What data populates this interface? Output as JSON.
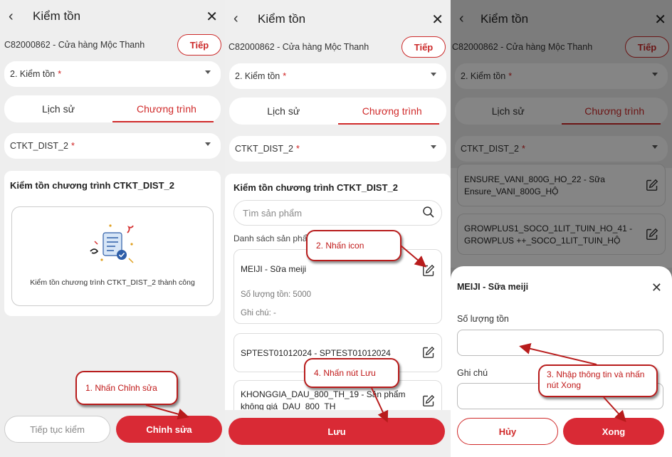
{
  "common": {
    "back_icon": "‹",
    "close_icon": "✕",
    "title": "Kiểm tồn",
    "store": "C82000862 - Cửa hàng Mộc Thanh",
    "next_label": "Tiếp",
    "step_select": "2. Kiểm tồn",
    "required_mark": "*",
    "tab_history": "Lịch sử",
    "tab_program": "Chương trình",
    "program_select": "CTKT_DIST_2"
  },
  "screen1": {
    "card_title": "Kiểm tồn chương trình CTKT_DIST_2",
    "success_message": "Kiểm tồn chương trình CTKT_DIST_2 thành công",
    "continue_label": "Tiếp tục kiểm",
    "edit_label": "Chỉnh sửa"
  },
  "screen2": {
    "card_title": "Kiểm tồn chương trình CTKT_DIST_2",
    "search_placeholder": "Tìm sản phẩm",
    "list_title": "Danh sách sản phẩ",
    "products": [
      {
        "name": "MEIJI - Sữa meiji",
        "qty": "Số lượng tồn: 5000",
        "note": "Ghi chú: -"
      },
      {
        "name": "SPTEST01012024 - SPTEST01012024"
      },
      {
        "name": "KHONGGIA_DAU_800_TH_19 - Sản phẩm không giá_DAU_800_TH"
      }
    ],
    "save_label": "Lưu"
  },
  "screen3": {
    "products": [
      "ENSURE_VANI_800G_HO_22 - Sữa Ensure_VANI_800G_HỘ",
      "GROWPLUS1_SOCO_1LIT_TUIN_HO_41 - GROWPLUS ++_SOCO_1LIT_TUIN_HỘ"
    ],
    "sheet_title": "MEIJI - Sữa meiji",
    "qty_label": "Số lượng tồn",
    "note_label": "Ghi chú",
    "cancel_label": "Hủy",
    "done_label": "Xong"
  },
  "callouts": {
    "c1": "1. Nhấn Chỉnh sửa",
    "c2": "2. Nhấn icon",
    "c3": "3. Nhập thông tin và nhấn nút Xong",
    "c4": "4. Nhấn nút Lưu"
  },
  "colors": {
    "accent": "#d92a35",
    "callout_border": "#b81c1c"
  }
}
